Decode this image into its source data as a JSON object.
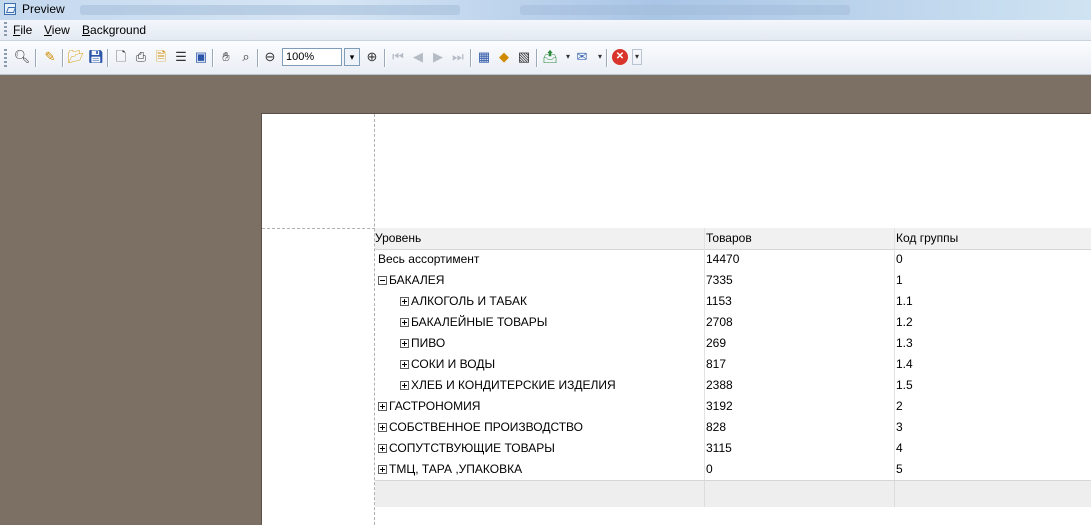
{
  "window": {
    "title": "Preview"
  },
  "menu": {
    "items": [
      "File",
      "View",
      "Background"
    ]
  },
  "toolbar": {
    "zoom_value": "100%",
    "icons": [
      "find-icon",
      "edit-icon",
      "open-icon",
      "save-icon",
      "page-setup-icon",
      "print-icon",
      "print-preview-icon",
      "margins-icon",
      "scale-icon",
      "hand-tool-icon",
      "magnifier-icon",
      "zoom-out-icon",
      "zoom-dropdown-icon",
      "zoom-in-icon",
      "first-page-icon",
      "prev-page-icon",
      "next-page-icon",
      "last-page-icon",
      "multiple-pages-icon",
      "page-color-icon",
      "watermark-icon",
      "export-icon",
      "send-email-icon",
      "close-preview-icon"
    ]
  },
  "report": {
    "columns": [
      "Уровень",
      "Товаров",
      "Код группы"
    ],
    "rows": [
      {
        "level": 0,
        "expander": "",
        "name": "Весь ассортимент",
        "count": "14470",
        "code": "0"
      },
      {
        "level": 0,
        "expander": "minus",
        "name": "БАКАЛЕЯ",
        "count": "7335",
        "code": "1"
      },
      {
        "level": 1,
        "expander": "plus",
        "name": "АЛКОГОЛЬ И ТАБАК",
        "count": "1153",
        "code": "1.1"
      },
      {
        "level": 1,
        "expander": "plus",
        "name": "БАКАЛЕЙНЫЕ ТОВАРЫ",
        "count": "2708",
        "code": "1.2"
      },
      {
        "level": 1,
        "expander": "plus",
        "name": "ПИВО",
        "count": "269",
        "code": "1.3"
      },
      {
        "level": 1,
        "expander": "plus",
        "name": "СОКИ И ВОДЫ",
        "count": "817",
        "code": "1.4"
      },
      {
        "level": 1,
        "expander": "plus",
        "name": "ХЛЕБ И КОНДИТЕРСКИЕ ИЗДЕЛИЯ",
        "count": "2388",
        "code": "1.5"
      },
      {
        "level": 0,
        "expander": "plus",
        "name": "ГАСТРОНОМИЯ",
        "count": "3192",
        "code": "2"
      },
      {
        "level": 0,
        "expander": "plus",
        "name": "СОБСТВЕННОЕ ПРОИЗВОДСТВО",
        "count": "828",
        "code": "3"
      },
      {
        "level": 0,
        "expander": "plus",
        "name": "СОПУТСТВУЮЩИЕ ТОВАРЫ",
        "count": "3115",
        "code": "4"
      },
      {
        "level": 0,
        "expander": "plus",
        "name": "ТМЦ, ТАРА ,УПАКОВКА",
        "count": "0",
        "code": "5"
      }
    ]
  },
  "colors": {
    "workspace": "#7c7065",
    "page": "#ffffff",
    "header_row": "#f1f1f1"
  }
}
